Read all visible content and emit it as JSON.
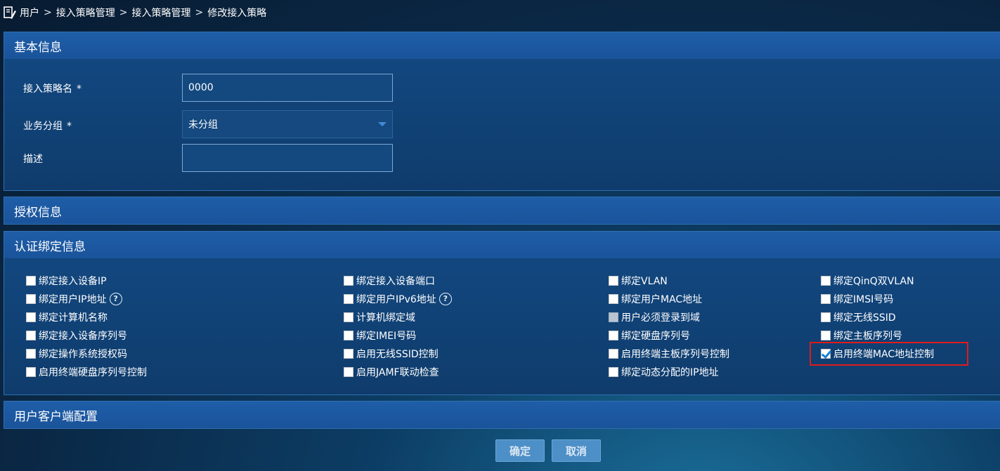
{
  "breadcrumb": {
    "items": [
      "用户",
      "接入策略管理",
      "接入策略管理",
      "修改接入策略"
    ],
    "separator": ">"
  },
  "sections": {
    "basic": {
      "title": "基本信息",
      "fields": {
        "policy_name": {
          "label": "接入策略名",
          "required_mark": "*",
          "value": "0000"
        },
        "service_group": {
          "label": "业务分组",
          "required_mark": "*",
          "value": "未分组"
        },
        "description": {
          "label": "描述",
          "value": ""
        }
      }
    },
    "auth": {
      "title": "授权信息"
    },
    "binding": {
      "title": "认证绑定信息",
      "checkboxes": [
        {
          "label": "绑定接入设备IP",
          "checked": false
        },
        {
          "label": "绑定用户IP地址",
          "checked": false,
          "help": "?"
        },
        {
          "label": "绑定计算机名称",
          "checked": false
        },
        {
          "label": "绑定接入设备序列号",
          "checked": false
        },
        {
          "label": "绑定操作系统授权码",
          "checked": false
        },
        {
          "label": "启用终端硬盘序列号控制",
          "checked": false
        },
        {
          "label": "绑定接入设备端口",
          "checked": false
        },
        {
          "label": "绑定用户IPv6地址",
          "checked": false,
          "help": "?"
        },
        {
          "label": "计算机绑定域",
          "checked": false
        },
        {
          "label": "绑定IMEI号码",
          "checked": false
        },
        {
          "label": "启用无线SSID控制",
          "checked": false
        },
        {
          "label": "启用JAMF联动检查",
          "checked": false
        },
        {
          "label": "绑定VLAN",
          "checked": false
        },
        {
          "label": "绑定用户MAC地址",
          "checked": false
        },
        {
          "label": "用户必须登录到域",
          "checked": false,
          "disabled": true
        },
        {
          "label": "绑定硬盘序列号",
          "checked": false
        },
        {
          "label": "启用终端主板序列号控制",
          "checked": false
        },
        {
          "label": "绑定动态分配的IP地址",
          "checked": false
        },
        {
          "label": "绑定QinQ双VLAN",
          "checked": false
        },
        {
          "label": "绑定IMSI号码",
          "checked": false
        },
        {
          "label": "绑定无线SSID",
          "checked": false
        },
        {
          "label": "绑定主板序列号",
          "checked": false
        },
        {
          "label": "启用终端MAC地址控制",
          "checked": true
        }
      ]
    },
    "client": {
      "title": "用户客户端配置"
    }
  },
  "buttons": {
    "ok": "确定",
    "cancel": "取消"
  },
  "colors": {
    "panel_header": "#1e5ea8",
    "panel_body": "#12477f",
    "highlight": "#e01b1b",
    "button": "#4d8fc7"
  }
}
